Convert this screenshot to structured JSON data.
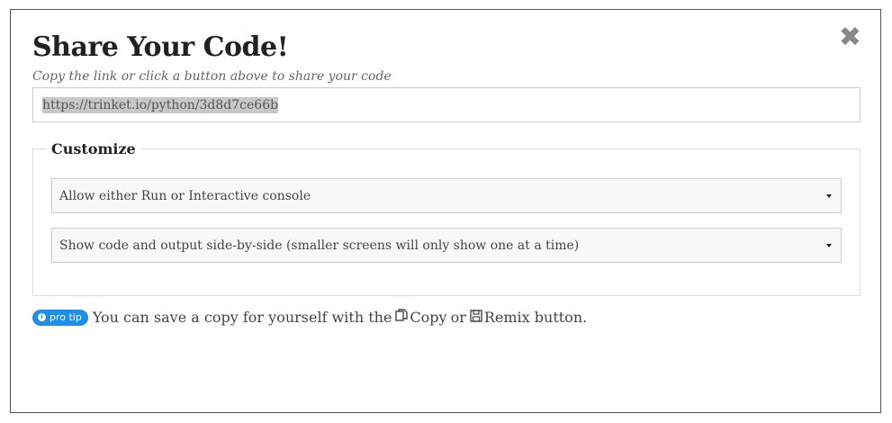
{
  "modal": {
    "title": "Share Your Code!",
    "close_glyph": "✖",
    "subtitle": "Copy the link or click a button above to share your code",
    "share_url": "https://trinket.io/python/3d8d7ce66b"
  },
  "customize": {
    "legend": "Customize",
    "console_select": {
      "selected": "Allow either Run or Interactive console"
    },
    "layout_select": {
      "selected": "Show code and output side-by-side (smaller screens will only show one at a time)"
    }
  },
  "pro_tip": {
    "badge_icon": "info-icon",
    "badge_label": "pro tip",
    "text_before": "You can save a copy for yourself with the",
    "copy_icon": "copy-icon",
    "copy_label": "Copy",
    "or_text": "or",
    "remix_icon": "save-icon",
    "remix_label": "Remix button."
  },
  "colors": {
    "accent": "#1e8ee8",
    "border": "#cccccc",
    "close": "#888888"
  }
}
